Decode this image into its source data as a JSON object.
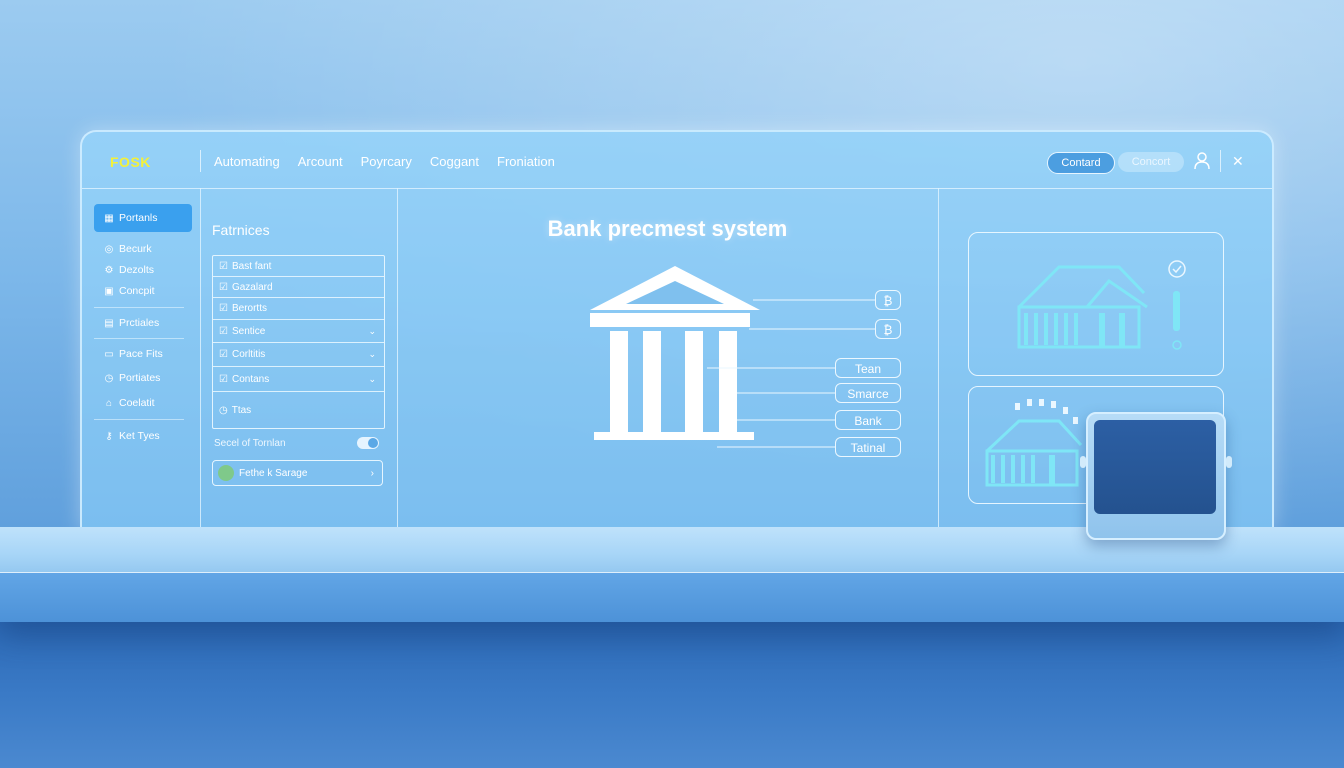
{
  "app": {
    "logo": "FOSK"
  },
  "nav": [
    "Automating",
    "Arcount",
    "Poyrcary",
    "Coggant",
    "Froniation"
  ],
  "header_actions": {
    "primary": "Contard",
    "secondary": "Concort"
  },
  "sidebar": {
    "items": [
      {
        "label": "Portanls",
        "icon": "grid-icon",
        "active": true
      },
      {
        "label": "Becurk",
        "icon": "shield-icon"
      },
      {
        "label": "Dezolts",
        "icon": "gear-icon"
      },
      {
        "label": "Concpit",
        "icon": "document-icon"
      },
      {
        "label": "Prctiales",
        "icon": "chart-icon"
      },
      {
        "label": "Pace Fits",
        "icon": "folder-icon"
      },
      {
        "label": "Portiates",
        "icon": "clock-icon"
      },
      {
        "label": "Coelatit",
        "icon": "home-icon"
      },
      {
        "label": "Ket Tyes",
        "icon": "key-icon"
      }
    ]
  },
  "features": {
    "title": "Fatrnices",
    "rows": [
      {
        "label": "Bast fant",
        "icon": "check-icon"
      },
      {
        "label": "Gazalard",
        "icon": "check-icon"
      },
      {
        "label": "Berortts",
        "icon": "check-icon"
      },
      {
        "label": "Sentice",
        "icon": "check-icon",
        "chevron": "⌄"
      },
      {
        "label": "Corltitis",
        "icon": "check-icon",
        "chevron": "⌄"
      },
      {
        "label": "Contans",
        "icon": "check-icon",
        "chevron": "⌄"
      },
      {
        "label": "Ttas",
        "icon": "clock-icon"
      }
    ],
    "toggle_label": "Secel of Tornlan",
    "toggle_on": true,
    "storage_label": "Fethe k Sarage",
    "storage_chevron": "›"
  },
  "center": {
    "title": "Bank precmest system",
    "right_tags": [
      "₿",
      "₿"
    ],
    "labels": [
      "Tean",
      "Smarce",
      "Bank",
      "Tatinal"
    ]
  },
  "colors": {
    "accent": "#3aa0ee",
    "logo": "#f3f13a",
    "screen": "#24528f"
  }
}
